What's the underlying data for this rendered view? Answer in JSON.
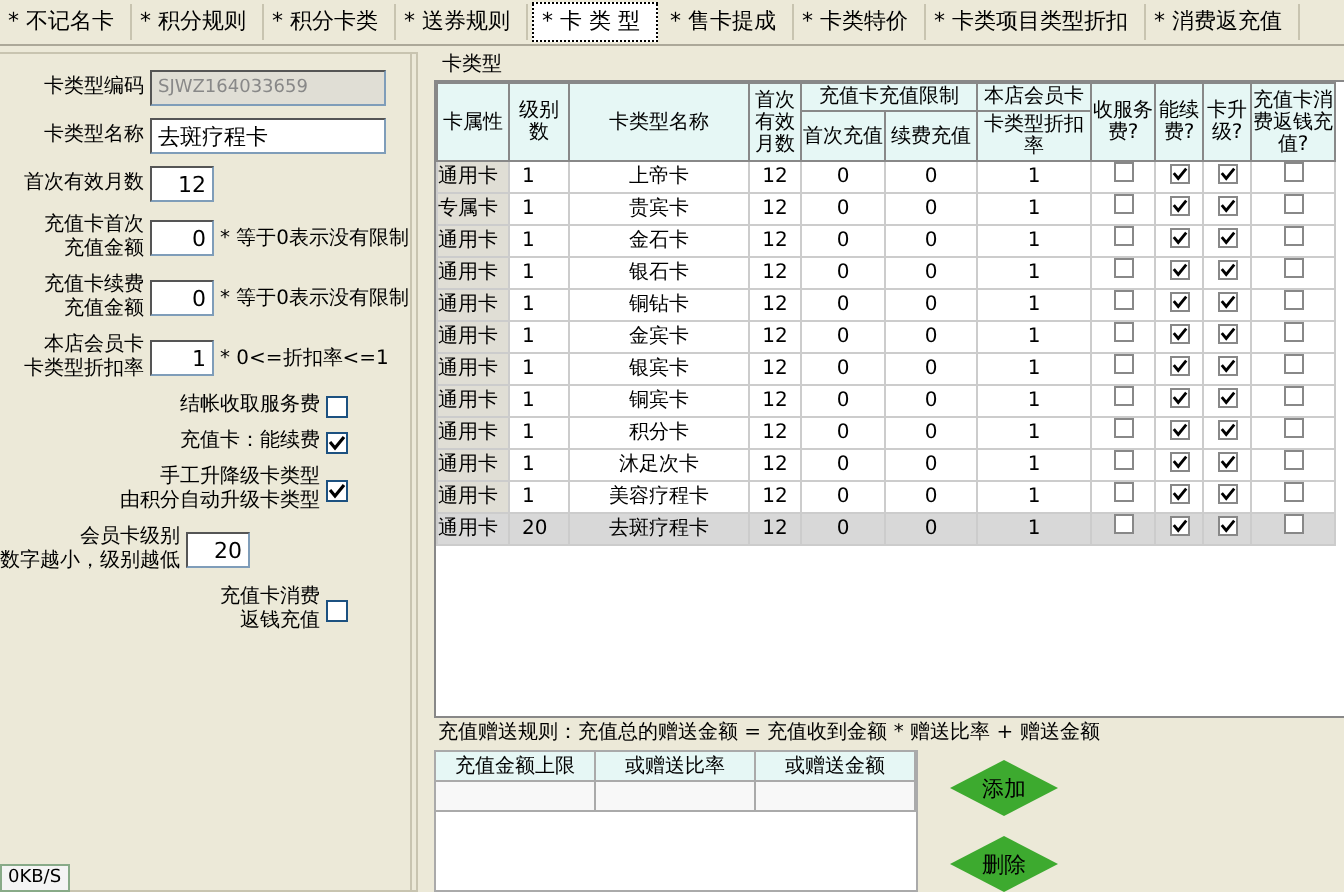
{
  "tabs": [
    {
      "label": "* 不记名卡",
      "selected": false
    },
    {
      "label": "* 积分规则",
      "selected": false
    },
    {
      "label": "* 积分卡类",
      "selected": false
    },
    {
      "label": "* 送券规则",
      "selected": false
    },
    {
      "label": "* 卡 类 型",
      "selected": true
    },
    {
      "label": "* 售卡提成",
      "selected": false
    },
    {
      "label": "* 卡类特价",
      "selected": false
    },
    {
      "label": "* 卡类项目类型折扣",
      "selected": false
    },
    {
      "label": "* 消费返充值",
      "selected": false
    }
  ],
  "form": [
    {
      "kind": "text",
      "label": [
        "卡类型编码"
      ],
      "value": "SJWZ164033659",
      "disabled": true
    },
    {
      "kind": "text",
      "label": [
        "卡类型名称"
      ],
      "value": "去斑疗程卡",
      "disabled": false
    },
    {
      "kind": "number",
      "label": [
        "首次有效月数"
      ],
      "value": "12",
      "disabled": false
    },
    {
      "kind": "number",
      "label": [
        "充值卡首次",
        "充值金额"
      ],
      "value": "0",
      "disabled": false,
      "note": "* 等于0表示没有限制"
    },
    {
      "kind": "number",
      "label": [
        "充值卡续费",
        "充值金额"
      ],
      "value": "0",
      "disabled": false,
      "note": "* 等于0表示没有限制"
    },
    {
      "kind": "number",
      "label": [
        "本店会员卡",
        "卡类型折扣率"
      ],
      "value": "1",
      "disabled": false,
      "note": "* 0<=折扣率<=1"
    },
    {
      "kind": "check",
      "label": [
        "结帐收取服务费"
      ],
      "checked": false
    },
    {
      "kind": "check",
      "label": [
        "充值卡：能续费"
      ],
      "checked": true
    },
    {
      "kind": "check",
      "label": [
        "手工升降级卡类型",
        "由积分自动升级卡类型"
      ],
      "checked": true
    },
    {
      "kind": "number",
      "label": [
        "会员卡级别",
        "数字越小，级别越低"
      ],
      "value": "20",
      "disabled": false
    },
    {
      "kind": "check",
      "label": [
        "充值卡消费",
        "返钱充值"
      ],
      "checked": false
    }
  ],
  "card_types": {
    "title": "卡类型",
    "headers": {
      "attribute": "卡属性",
      "level": "级别数",
      "name": "卡类型名称",
      "months": "首次有效月数",
      "limit_group": "充值卡充值限制",
      "first": "首次充值",
      "renew": "续费充值",
      "member_group": "本店会员卡",
      "discount": "卡类型折扣率",
      "fee": "收服务费?",
      "can_renew": "能续费?",
      "upgrade": "卡升级?",
      "refund": "充值卡消费返钱充值?"
    },
    "rows": [
      {
        "attribute": "通用卡",
        "level": "1",
        "name": "上帝卡",
        "months": "12",
        "first": "0",
        "renew": "0",
        "discount": "1",
        "fee": false,
        "can_renew": true,
        "upgrade": true,
        "refund": false,
        "selected": false
      },
      {
        "attribute": "专属卡",
        "level": "1",
        "name": "贵宾卡",
        "months": "12",
        "first": "0",
        "renew": "0",
        "discount": "1",
        "fee": false,
        "can_renew": true,
        "upgrade": true,
        "refund": false,
        "selected": false
      },
      {
        "attribute": "通用卡",
        "level": "1",
        "name": "金石卡",
        "months": "12",
        "first": "0",
        "renew": "0",
        "discount": "1",
        "fee": false,
        "can_renew": true,
        "upgrade": true,
        "refund": false,
        "selected": false
      },
      {
        "attribute": "通用卡",
        "level": "1",
        "name": "银石卡",
        "months": "12",
        "first": "0",
        "renew": "0",
        "discount": "1",
        "fee": false,
        "can_renew": true,
        "upgrade": true,
        "refund": false,
        "selected": false
      },
      {
        "attribute": "通用卡",
        "level": "1",
        "name": "铜钻卡",
        "months": "12",
        "first": "0",
        "renew": "0",
        "discount": "1",
        "fee": false,
        "can_renew": true,
        "upgrade": true,
        "refund": false,
        "selected": false
      },
      {
        "attribute": "通用卡",
        "level": "1",
        "name": "金宾卡",
        "months": "12",
        "first": "0",
        "renew": "0",
        "discount": "1",
        "fee": false,
        "can_renew": true,
        "upgrade": true,
        "refund": false,
        "selected": false
      },
      {
        "attribute": "通用卡",
        "level": "1",
        "name": "银宾卡",
        "months": "12",
        "first": "0",
        "renew": "0",
        "discount": "1",
        "fee": false,
        "can_renew": true,
        "upgrade": true,
        "refund": false,
        "selected": false
      },
      {
        "attribute": "通用卡",
        "level": "1",
        "name": "铜宾卡",
        "months": "12",
        "first": "0",
        "renew": "0",
        "discount": "1",
        "fee": false,
        "can_renew": true,
        "upgrade": true,
        "refund": false,
        "selected": false
      },
      {
        "attribute": "通用卡",
        "level": "1",
        "name": "积分卡",
        "months": "12",
        "first": "0",
        "renew": "0",
        "discount": "1",
        "fee": false,
        "can_renew": true,
        "upgrade": true,
        "refund": false,
        "selected": false
      },
      {
        "attribute": "通用卡",
        "level": "1",
        "name": "沐足次卡",
        "months": "12",
        "first": "0",
        "renew": "0",
        "discount": "1",
        "fee": false,
        "can_renew": true,
        "upgrade": true,
        "refund": false,
        "selected": false
      },
      {
        "attribute": "通用卡",
        "level": "1",
        "name": "美容疗程卡",
        "months": "12",
        "first": "0",
        "renew": "0",
        "discount": "1",
        "fee": false,
        "can_renew": true,
        "upgrade": true,
        "refund": false,
        "selected": false
      },
      {
        "attribute": "通用卡",
        "level": "20",
        "name": "去斑疗程卡",
        "months": "12",
        "first": "0",
        "renew": "0",
        "discount": "1",
        "fee": false,
        "can_renew": true,
        "upgrade": true,
        "refund": false,
        "selected": true
      }
    ]
  },
  "bonus": {
    "rule": "充值赠送规则：充值总的赠送金额 = 充值收到金额 * 赠送比率 + 赠送金额",
    "columns": [
      "充值金额上限",
      "或赠送比率",
      "或赠送金额"
    ],
    "buttons": [
      "添加",
      "删除"
    ]
  },
  "status": "0KB/S"
}
